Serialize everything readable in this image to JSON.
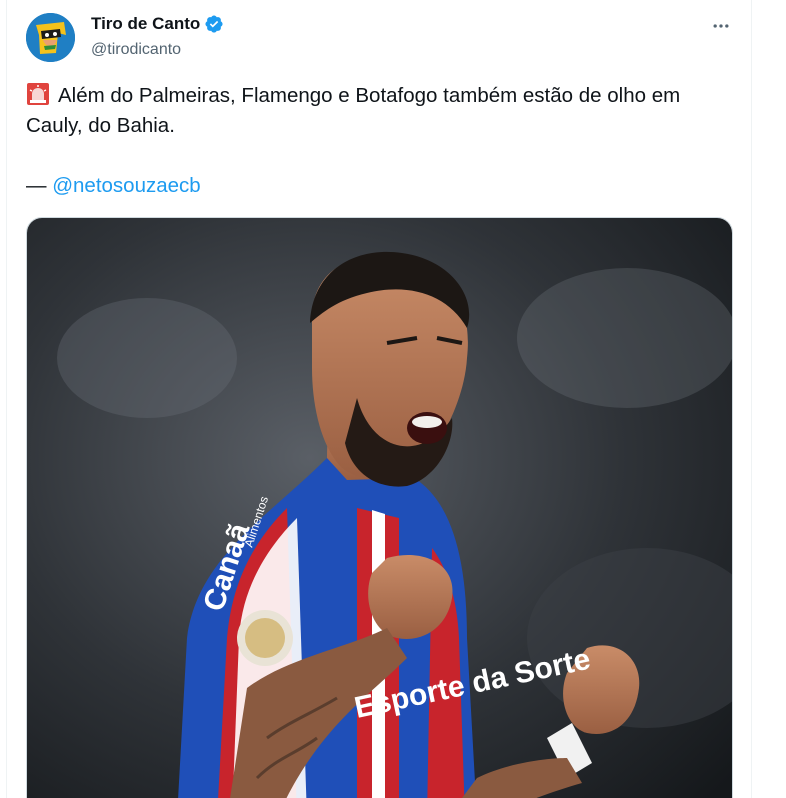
{
  "tweet": {
    "author": {
      "display_name": "Tiro de Canto",
      "handle": "@tirodicanto",
      "verified": true,
      "avatar_icon": "cartoon-face-avatar"
    },
    "more_icon": "more-horizontal-icon",
    "text": {
      "emoji": "rotating-light-icon",
      "line1": "Além do Palmeiras, Flamengo e Botafogo também estão de olho em",
      "line2": "Cauly, do Bahia.",
      "credit_dash": "—",
      "credit_mention": "@netosouzaecb"
    },
    "media": {
      "type": "photo",
      "jersey_sponsor": "Canaã",
      "jersey_sponsor_sub": "Alimentos",
      "jersey_front": "Esporte da Sorte"
    }
  },
  "colors": {
    "link": "#1d9bf0",
    "verified": "#1d9bf0",
    "text": "#0f1419",
    "secondary": "#536471",
    "jersey_blue": "#1f4fb8",
    "jersey_red": "#c8242c"
  }
}
